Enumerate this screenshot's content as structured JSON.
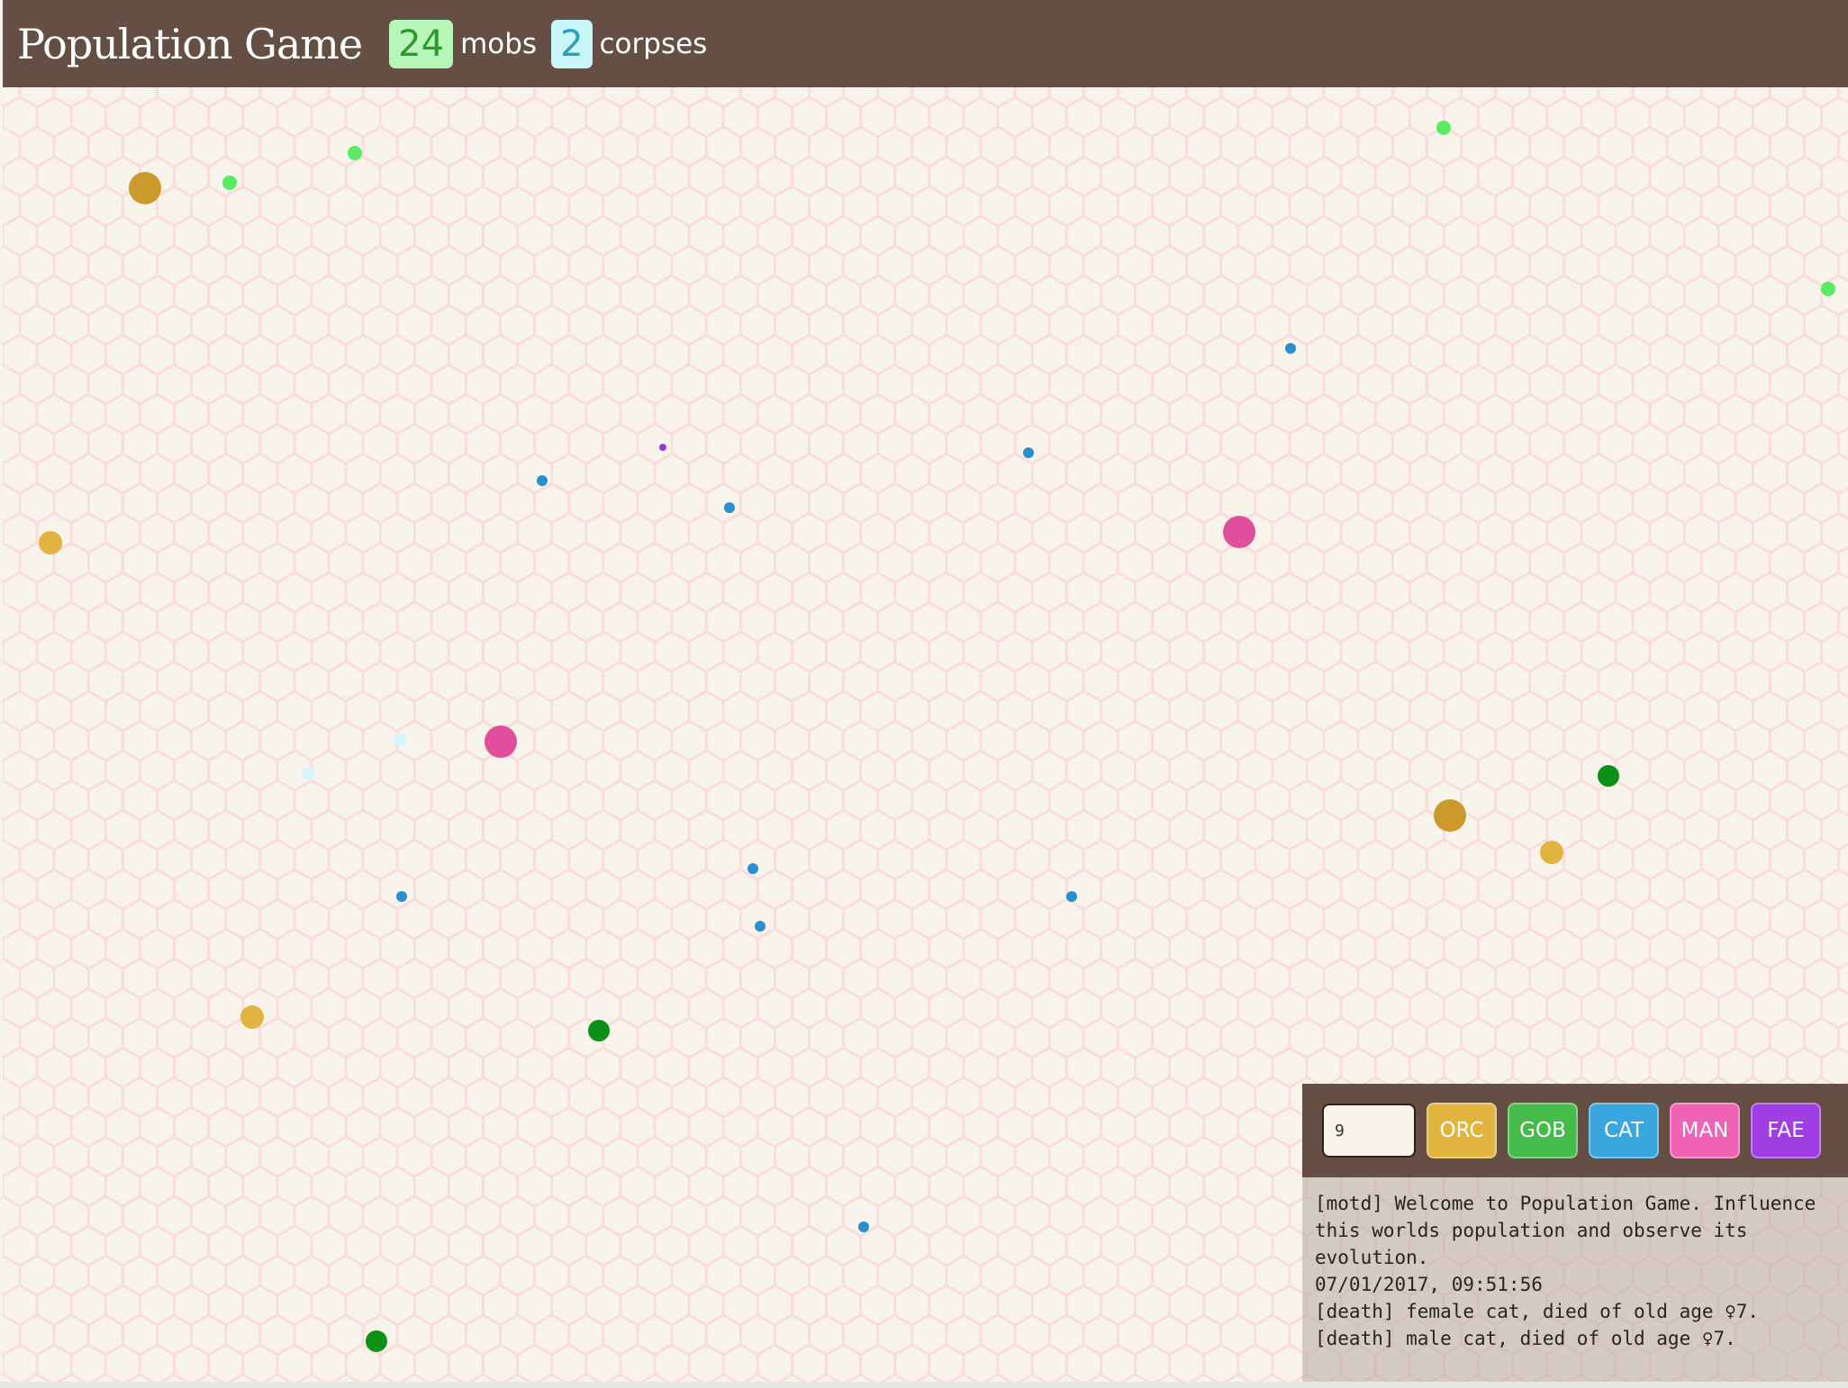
{
  "header": {
    "title": "Population Game",
    "mobs_count": "24",
    "mobs_label": "mobs",
    "corpses_count": "2",
    "corpses_label": "corpses"
  },
  "colors": {
    "header_bg": "#654f44",
    "world_bg": "#f8f4ec",
    "hex_line": "#fbdcdc",
    "orc": "#e1b43f",
    "gob": "#46bb4b",
    "cat": "#3aa6de",
    "man": "#f062b4",
    "fae": "#a03ee4"
  },
  "controls": {
    "count_value": "9",
    "buttons": [
      {
        "label": "ORC",
        "color": "#e1b43f"
      },
      {
        "label": "GOB",
        "color": "#46bb4b"
      },
      {
        "label": "CAT",
        "color": "#3aa6de"
      },
      {
        "label": "MAN",
        "color": "#f062b4"
      },
      {
        "label": "FAE",
        "color": "#a03ee4"
      }
    ]
  },
  "log": [
    "[motd] Welcome to Population Game. Influence this worlds population and observe its evolution.",
    "07/01/2017, 09:51:56",
    "[death] female cat, died of old age ♀7.",
    "[death] male cat, died of old age ♀7."
  ]
}
